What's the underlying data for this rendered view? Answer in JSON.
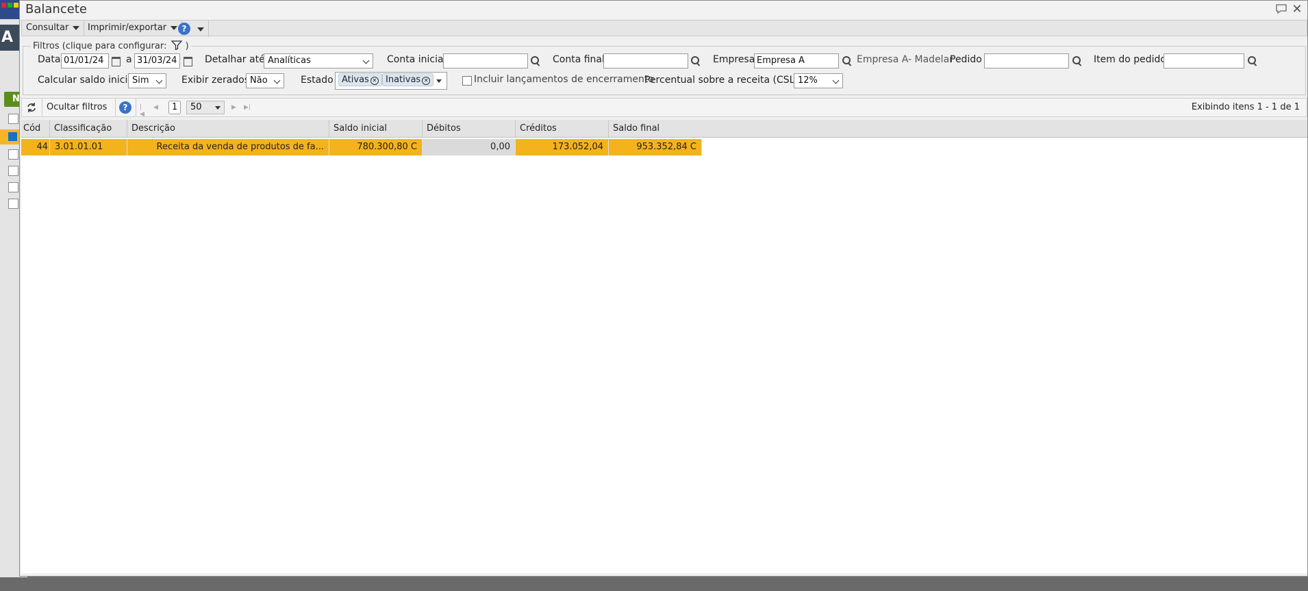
{
  "window": {
    "title": "Balancete"
  },
  "menu": {
    "consultar": "Consultar",
    "imprimir": "Imprimir/exportar"
  },
  "filters": {
    "legend": "Filtros (clique para configurar:",
    "legend_end": ")",
    "data_label": "Data",
    "date_from": "01/01/24",
    "date_sep": "a",
    "date_to": "31/03/24",
    "detalhar_label": "Detalhar até",
    "detalhar_value": "Analíticas",
    "conta_inicial_label": "Conta inicial",
    "conta_inicial_value": "",
    "conta_final_label": "Conta final",
    "conta_final_value": "",
    "empresa_label": "Empresa",
    "empresa_value": "Empresa A",
    "empresa_desc": "Empresa A- Madelar",
    "pedido_label": "Pedido",
    "pedido_value": "",
    "item_pedido_label": "Item do pedido",
    "item_pedido_value": "",
    "calcular_label": "Calcular saldo inicial",
    "calcular_value": "Sim",
    "zerados_label": "Exibir zerados",
    "zerados_value": "Não",
    "estado_label": "Estado",
    "estado_tags": [
      "Ativas",
      "Inativas"
    ],
    "incluir_label": "Incluir lançamentos de encerramento",
    "percentual_label": "Percentual sobre a receita (CSLL)",
    "percentual_value": "12%"
  },
  "toolbar": {
    "hide_filters": "Ocultar filtros",
    "page": "1",
    "page_size": "50",
    "status": "Exibindo itens 1 - 1 de 1"
  },
  "table": {
    "columns": [
      "Cód",
      "Classificação",
      "Descrição",
      "Saldo inicial",
      "Débitos",
      "Créditos",
      "Saldo final"
    ],
    "rows": [
      {
        "cod": "44",
        "classificacao": "3.01.01.01",
        "descricao": "Receita da venda de produtos de fa...",
        "saldo_inicial": "780.300,80 C",
        "debitos": "0,00",
        "creditos": "173.052,04",
        "saldo_final": "953.352,84 C"
      }
    ]
  },
  "colors": {
    "highlight": "#f4b21c",
    "help": "#3a73c7"
  }
}
